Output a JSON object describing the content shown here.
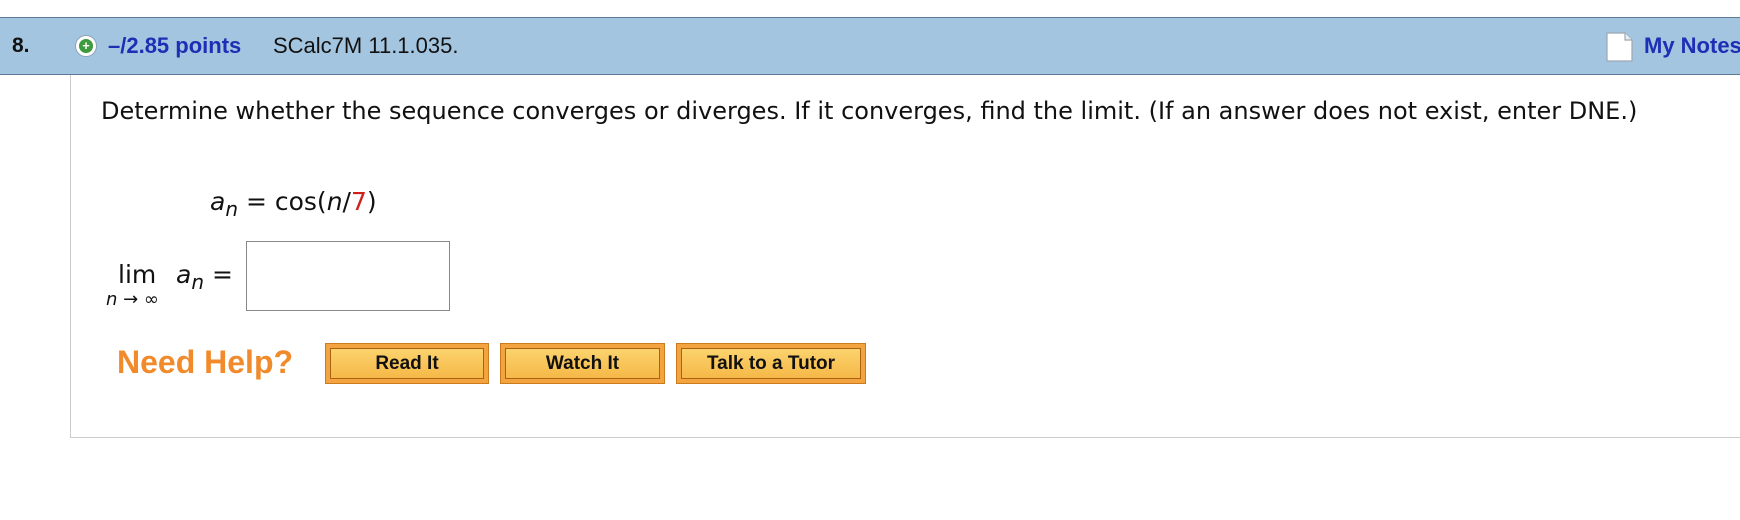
{
  "question": {
    "number": "8.",
    "points": "–/2.85 points",
    "code": "SCalc7M 11.1.035.",
    "notes_label": "My Notes"
  },
  "prompt": {
    "text": "Determine whether the sequence converges or diverges. If it converges, find the limit. (If an answer does not exist, enter DNE.)"
  },
  "formula": {
    "var": "a",
    "sub": "n",
    "equals": " = cos(",
    "n": "n",
    "slash": "/",
    "divisor": "7",
    "close": ")"
  },
  "limit": {
    "lim": "lim",
    "under": "n → ∞",
    "var": "a",
    "sub": "n",
    "equals": " =",
    "answer_value": ""
  },
  "help": {
    "label": "Need Help?",
    "buttons": [
      "Read It",
      "Watch It",
      "Talk to a Tutor"
    ]
  },
  "colors": {
    "header_bg": "#a4c5df",
    "link_blue": "#1d2fb5",
    "help_orange": "#f08a2a",
    "button_orange": "#f3a33f",
    "red": "#d0201a"
  },
  "icons": {
    "plus": "plus-circle-icon",
    "notes": "document-icon"
  }
}
